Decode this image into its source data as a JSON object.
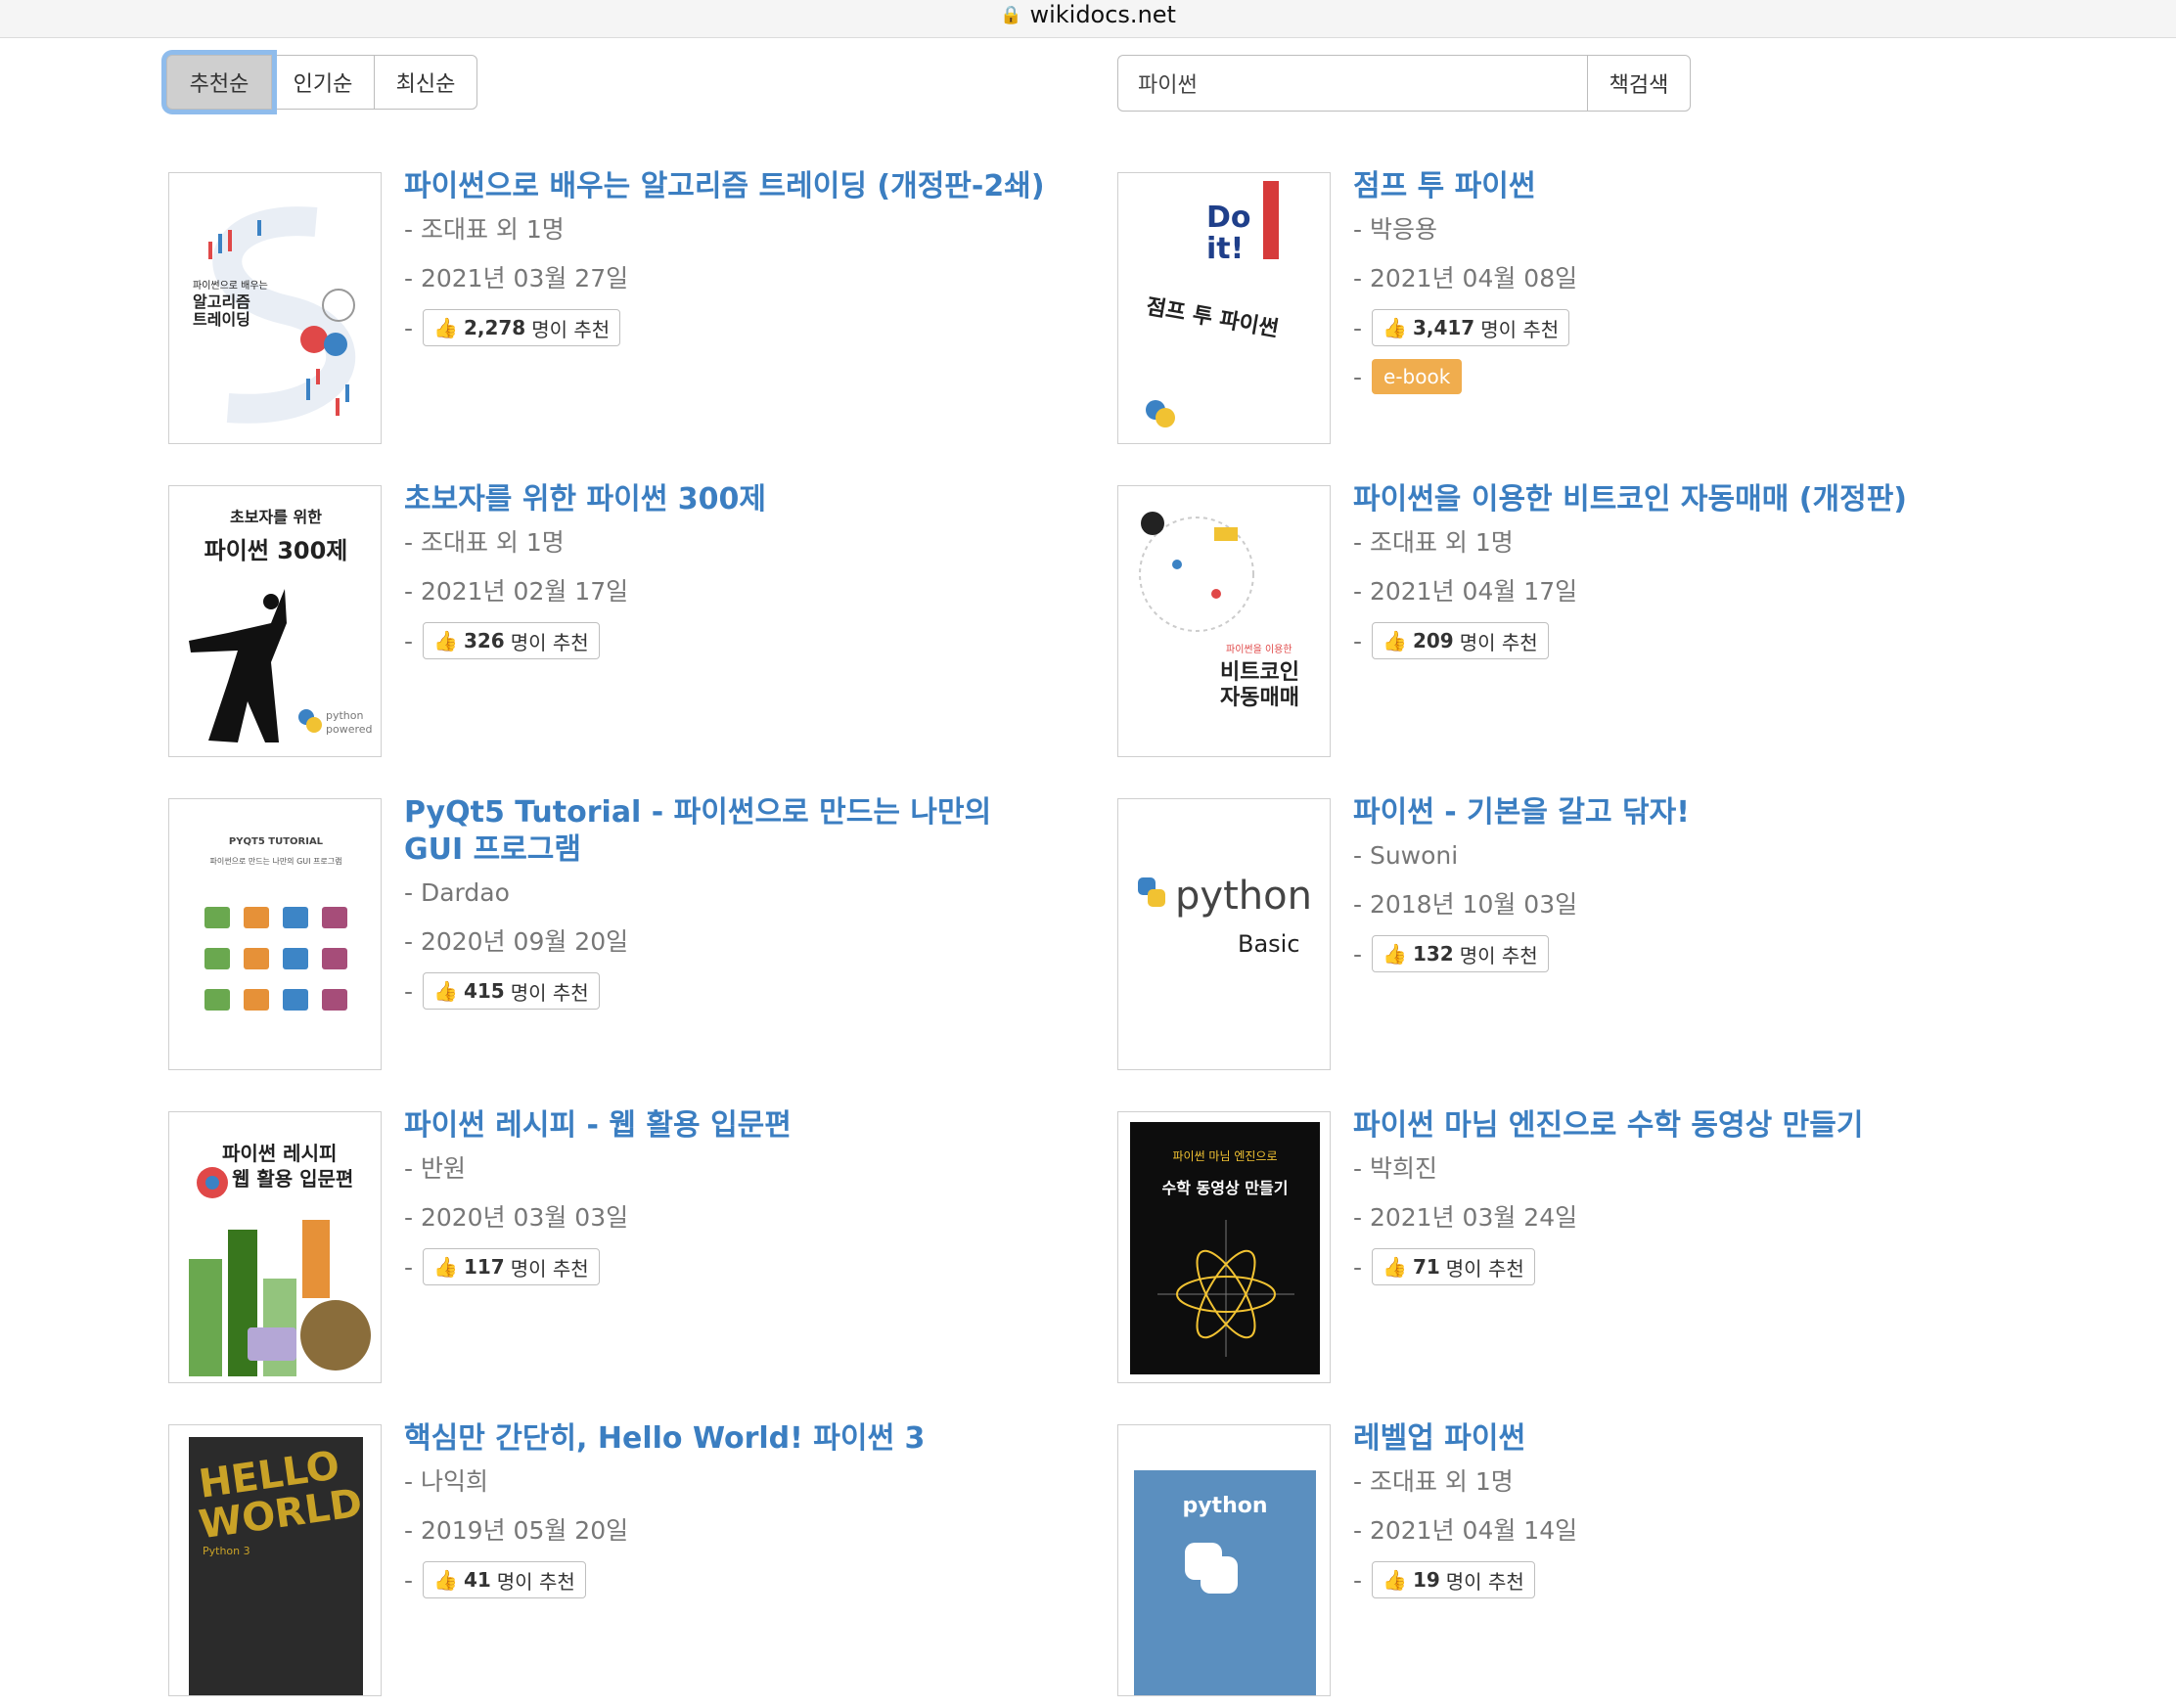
{
  "browser": {
    "url": "wikidocs.net"
  },
  "sort": {
    "recommended": "추천순",
    "popular": "인기순",
    "latest": "최신순"
  },
  "search": {
    "value": "파이썬",
    "button": "책검색"
  },
  "like_suffix": "명이 추천",
  "books": [
    {
      "title": "파이썬으로 배우는 알고리즘 트레이딩 (개정판-2쇄)",
      "author": "- 조대표 외 1명",
      "date": "- 2021년 03월 27일",
      "likes": "2,278",
      "cover": {
        "t1": "파이썬으로 배우는",
        "t2": "알고리즘",
        "t3": "트레이딩"
      }
    },
    {
      "title": "점프 투 파이썬",
      "author": "- 박응용",
      "date": "- 2021년 04월 08일",
      "likes": "3,417",
      "ebook": "e-book",
      "cover": {
        "t1": "Do it!",
        "t2": "점프 투 파이썬"
      }
    },
    {
      "title": "초보자를 위한 파이썬 300제",
      "author": "- 조대표 외 1명",
      "date": "- 2021년 02월 17일",
      "likes": "326",
      "cover": {
        "t1": "초보자를 위한",
        "t2": "파이썬 300제",
        "t3": "python",
        "t4": "powered"
      }
    },
    {
      "title": "파이썬을 이용한 비트코인 자동매매 (개정판)",
      "author": "- 조대표 외 1명",
      "date": "- 2021년 04월 17일",
      "likes": "209",
      "cover": {
        "t1": "파이썬을 이용한",
        "t2": "비트코인",
        "t3": "자동매매"
      }
    },
    {
      "title": "PyQt5 Tutorial - 파이썬으로 만드는 나만의 GUI 프로그램",
      "author": "- Dardao",
      "date": "- 2020년 09월 20일",
      "likes": "415",
      "cover": {
        "t1": "PYQT5 TUTORIAL",
        "t2": "파이썬으로 만드는 나만의 GUI 프로그램"
      }
    },
    {
      "title": "파이썬 - 기본을 갈고 닦자!",
      "author": "- Suwoni",
      "date": "- 2018년 10월 03일",
      "likes": "132",
      "cover": {
        "t1": "python",
        "t2": "Basic"
      }
    },
    {
      "title": "파이썬 레시피 - 웹 활용 입문편",
      "author": "- 반원",
      "date": "- 2020년 03월 03일",
      "likes": "117",
      "cover": {
        "t1": "파이썬 레시피",
        "t2": "웹 활용 입문편"
      }
    },
    {
      "title": "파이썬 마님 엔진으로 수학 동영상 만들기",
      "author": "- 박희진",
      "date": "- 2021년 03월 24일",
      "likes": "71",
      "cover": {
        "t1": "파이썬 마님 엔진으로",
        "t2": "수학 동영상 만들기"
      }
    },
    {
      "title": "핵심만 간단히, Hello World! 파이썬 3",
      "author": "- 나익희",
      "date": "- 2019년 05월 20일",
      "likes": "41",
      "cover": {
        "t1": "HELLO",
        "t2": "WORLD",
        "t3": "Python 3"
      }
    },
    {
      "title": "레벨업 파이썬",
      "author": "- 조대표 외 1명",
      "date": "- 2021년 04월 14일",
      "likes": "19",
      "cover": {
        "t1": "python"
      }
    }
  ],
  "colors": {
    "link": "#3b7ec1",
    "ebook": "#f0ad4e",
    "focus": "#8fbcec"
  }
}
